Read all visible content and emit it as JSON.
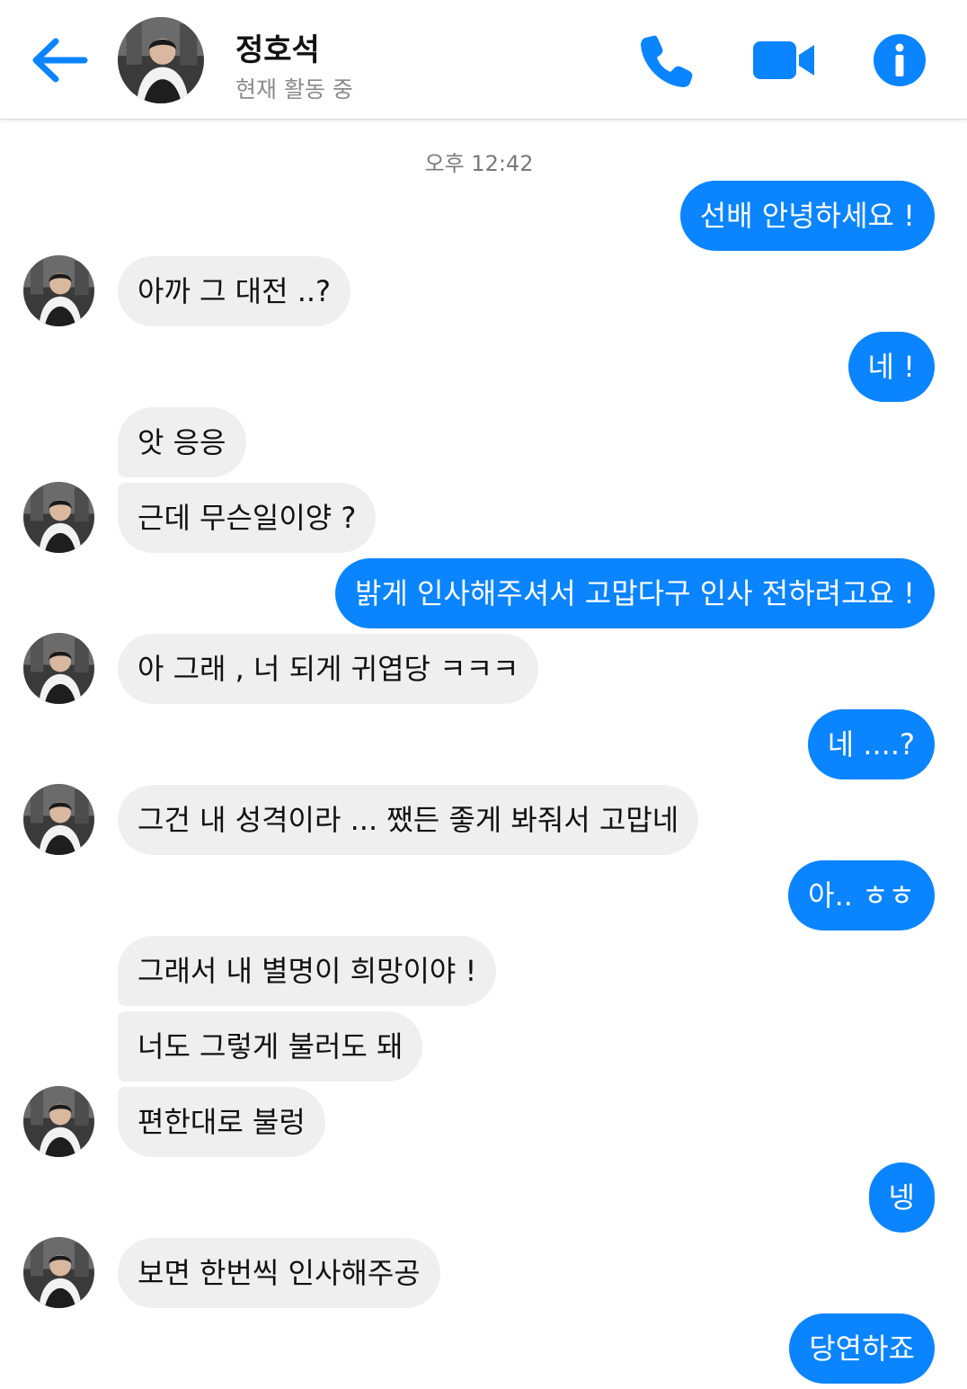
{
  "header": {
    "back_icon": "arrow-left-icon",
    "contact_name": "정호석",
    "status": "현재 활동 중",
    "icons": [
      "phone-icon",
      "video-camera-icon",
      "info-icon"
    ],
    "accent_color": "#0a84ff"
  },
  "timestamp": "오후 12:42",
  "messages": [
    {
      "side": "out",
      "text": "선배 안녕하세요 !"
    },
    {
      "side": "in",
      "text": "아까 그 대전 ..?"
    },
    {
      "side": "out",
      "text": "네 !"
    },
    {
      "side": "in",
      "text": "앗 응응"
    },
    {
      "side": "in",
      "text": "근데 무슨일이양 ?"
    },
    {
      "side": "out",
      "text": "밝게 인사해주셔서 고맙다구 인사 전하려고요 !"
    },
    {
      "side": "in",
      "text": "아 그래 , 너 되게 귀엽당 ㅋㅋㅋ"
    },
    {
      "side": "out",
      "text": "네 ....?"
    },
    {
      "side": "in",
      "text": "그건 내 성격이라 ... 쨌든 좋게 봐줘서 고맙네"
    },
    {
      "side": "out",
      "text": "아.. ㅎㅎ"
    },
    {
      "side": "in",
      "text": "그래서 내 별명이 희망이야 !"
    },
    {
      "side": "in",
      "text": "너도 그렇게 불러도 돼"
    },
    {
      "side": "in",
      "text": "편한대로 불렁"
    },
    {
      "side": "out",
      "text": "넹"
    },
    {
      "side": "in",
      "text": "보면 한번씩 인사해주공"
    },
    {
      "side": "out",
      "text": "당연하죠"
    }
  ]
}
